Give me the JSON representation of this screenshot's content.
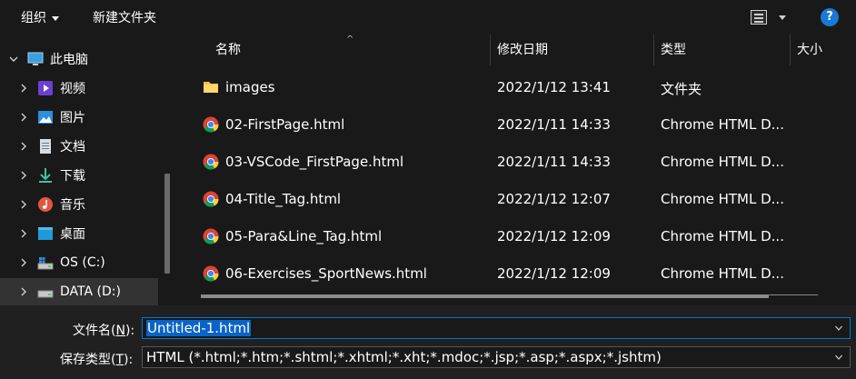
{
  "toolbar": {
    "organize_label": "组织",
    "new_folder_label": "新建文件夹",
    "help_label": "?"
  },
  "nav": {
    "items": [
      {
        "label": "此电脑",
        "icon": "computer-icon"
      },
      {
        "label": "视频",
        "icon": "video-icon"
      },
      {
        "label": "图片",
        "icon": "picture-icon"
      },
      {
        "label": "文档",
        "icon": "document-icon"
      },
      {
        "label": "下载",
        "icon": "download-icon"
      },
      {
        "label": "音乐",
        "icon": "music-icon"
      },
      {
        "label": "桌面",
        "icon": "desktop-icon"
      },
      {
        "label": "OS (C:)",
        "icon": "drive-c-icon"
      },
      {
        "label": "DATA (D:)",
        "icon": "drive-d-icon"
      }
    ]
  },
  "columns": {
    "name": "名称",
    "date": "修改日期",
    "type": "类型",
    "size": "大小"
  },
  "files": [
    {
      "name": "images",
      "date": "2022/1/12 13:41",
      "type": "文件夹",
      "icon": "folder-icon"
    },
    {
      "name": "02-FirstPage.html",
      "date": "2022/1/11 14:33",
      "type": "Chrome HTML D...",
      "icon": "chrome-icon"
    },
    {
      "name": "03-VSCode_FirstPage.html",
      "date": "2022/1/11 14:33",
      "type": "Chrome HTML D...",
      "icon": "chrome-icon"
    },
    {
      "name": "04-Title_Tag.html",
      "date": "2022/1/12 12:07",
      "type": "Chrome HTML D...",
      "icon": "chrome-icon"
    },
    {
      "name": "05-Para&Line_Tag.html",
      "date": "2022/1/12 12:09",
      "type": "Chrome HTML D...",
      "icon": "chrome-icon"
    },
    {
      "name": "06-Exercises_SportNews.html",
      "date": "2022/1/12 12:09",
      "type": "Chrome HTML D...",
      "icon": "chrome-icon"
    }
  ],
  "footer": {
    "filename_label_pre": "文件名(",
    "filename_label_key": "N",
    "filename_label_post": "):",
    "filename_value": "Untitled-1.html",
    "filetype_label_pre": "保存类型(",
    "filetype_label_key": "T",
    "filetype_label_post": "):",
    "filetype_value": "HTML (*.html;*.htm;*.shtml;*.xhtml;*.xht;*.mdoc;*.jsp;*.asp;*.aspx;*.jshtm)"
  },
  "colors": {
    "accent": "#0078d4",
    "selection": "#0a64c8",
    "background": "#191919"
  }
}
